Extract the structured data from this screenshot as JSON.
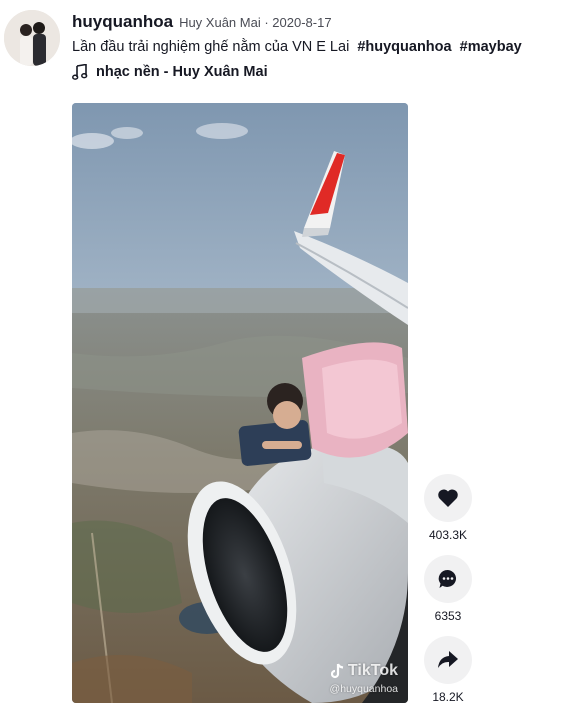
{
  "post": {
    "username": "huyquanhoa",
    "display_name": "Huy Xuân Mai",
    "date": "2020-8-17",
    "caption_text": "Lần đầu trải nghiệm ghế nằm của VN E Lai",
    "hashtags": [
      "#huyquanhoa",
      "#maybay"
    ],
    "music": "nhạc nền - Huy Xuân Mai"
  },
  "video": {
    "watermark_brand": "TikTok",
    "watermark_handle": "@huyquanhoa"
  },
  "actions": {
    "likes": "403.3K",
    "comments": "6353",
    "shares": "18.2K"
  },
  "icons": {
    "music": "music-note-icon",
    "like": "heart-icon",
    "comment": "comment-icon",
    "share": "share-icon",
    "brand": "tiktok-logo-icon"
  },
  "colors": {
    "text": "#161823",
    "action_bg": "#f1f1f2",
    "meta": "#4a4c55"
  }
}
